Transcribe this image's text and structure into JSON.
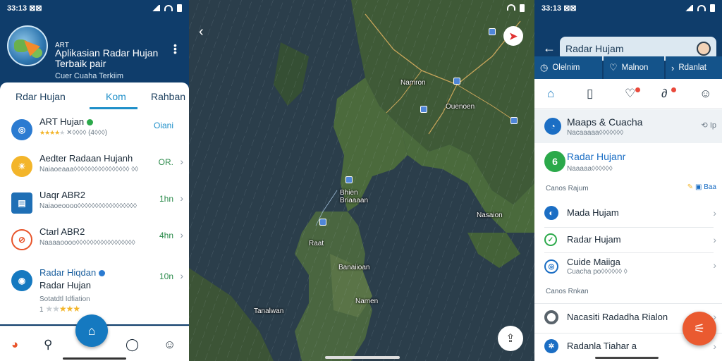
{
  "left": {
    "status": {
      "time": "33:13 ⊠⊠"
    },
    "header": {
      "line1": "ART",
      "line2": "Aplikasian Radar Hujan",
      "line3": "Terbaik pair",
      "subtitle": "Cuer Cuaha Terkiim"
    },
    "tabs": [
      {
        "label": "Rdar Hujan"
      },
      {
        "label": "Kom"
      },
      {
        "label": "Rahban"
      }
    ],
    "items": [
      {
        "name": "ART Hujan",
        "sub": "✕◊◊◊◊ (4◊◊◊)",
        "value": "Oiani",
        "icon_color": "#2b7bd1",
        "icon": "radar-icon"
      },
      {
        "name": "Aedter Radaan Hujanh",
        "sub": "Naiaoeaaa◊◊◊◊◊◊◊◊◊◊◊◊◊◊◊◊ ◊◊",
        "value": "OR.",
        "icon_color": "#f3b52a",
        "icon": "sun-cloud-icon"
      },
      {
        "name": "Uaqr ABR2",
        "sub": "Naiaoeoooo◊◊◊◊◊◊◊◊◊◊◊◊◊◊◊◊◊",
        "value": "1hn",
        "icon_color": "#1f6fb5",
        "icon": "house-screen-icon"
      },
      {
        "name": "Ctarl ABR2",
        "sub": "Naaaaoooo◊◊◊◊◊◊◊◊◊◊◊◊◊◊◊◊◊",
        "value": "4hn",
        "icon_color": "#e8542a",
        "icon": "no-rain-icon"
      },
      {
        "name": "Radar Hiqdan",
        "name2": "Radar Hujan",
        "sub": "Sotatdtl Idfiation",
        "rating": "1",
        "value": "10n",
        "icon_color": "#1579c0",
        "icon": "cloud-radar-icon"
      }
    ],
    "nav": [
      "chrome-icon",
      "search-icon",
      "home-icon",
      "chat-icon",
      "profile-icon"
    ]
  },
  "map": {
    "labels": [
      {
        "text": "Namron"
      },
      {
        "text": "Ouenoen"
      },
      {
        "text": "Bhien\nBriaaaan"
      },
      {
        "text": "Raat"
      },
      {
        "text": "Banaiioan"
      },
      {
        "text": "Namen"
      },
      {
        "text": "Nasaion"
      },
      {
        "text": "Tanalwan"
      }
    ]
  },
  "right": {
    "status": {
      "time": "33:13 ⊠⊠"
    },
    "search": {
      "value": "Radar Hujam"
    },
    "tabs": [
      {
        "label": "Olelnim",
        "icon": "clock-icon"
      },
      {
        "label": "Malnon",
        "icon": "heart-icon"
      },
      {
        "label": "Rdanlat",
        "icon": "chevron-right-icon"
      }
    ],
    "featured": {
      "name": "Maaps & Cuacha",
      "sub": "Nacaaaaa◊◊◊◊◊◊◊",
      "action": "Ip"
    },
    "top_pick": {
      "name": "Radar Hujanr",
      "sub": "Naaaaa◊◊◊◊◊◊"
    },
    "section1": "Canos Rajum",
    "section1_action": "Baa",
    "list1": [
      {
        "name": "Mada Hujam",
        "icon": "satellite-icon",
        "icon_color": "#1b6ec4"
      },
      {
        "name": "Radar Hujam",
        "icon": "check-circle-icon",
        "icon_color": "#2ba94a"
      },
      {
        "name": "Cuide Maiiga",
        "sub": "Cuacha po◊◊◊◊◊◊ ◊",
        "icon": "globe-icon",
        "icon_color": "#1b6ec4"
      }
    ],
    "section2": "Canos Rnkan",
    "list2": [
      {
        "name": "Nacasiti Radadha Rialon",
        "icon": "target-icon",
        "icon_color": "#59636b"
      },
      {
        "name": "Radanla Tiahar a",
        "icon": "grid-icon",
        "icon_color": "#1b6ec4"
      }
    ]
  }
}
